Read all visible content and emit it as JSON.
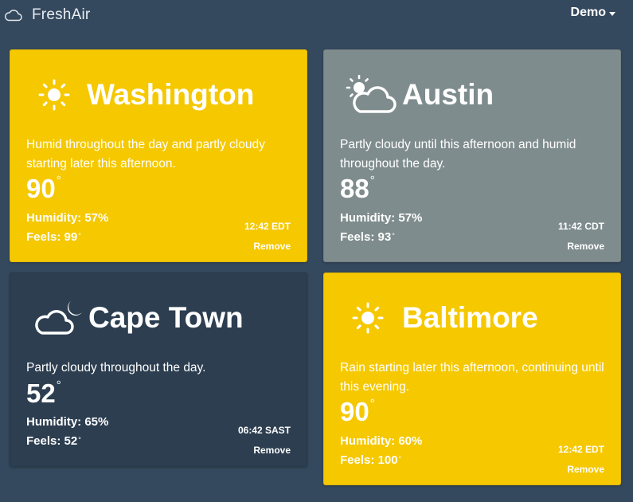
{
  "app": {
    "name": "FreshAir",
    "logo_icon": "cloud-outline-icon"
  },
  "user_menu": {
    "label": "Demo"
  },
  "colors": {
    "background": "#34495e",
    "sunny": "#f5c800",
    "cloudy": "#7f8c8d",
    "night": "#2c3e50"
  },
  "cards": [
    {
      "city": "Washington",
      "icon": "sun-icon",
      "summary": "Humid throughout the day and partly cloudy starting later this afternoon.",
      "temperature": "90",
      "humidity": "Humidity: 57%",
      "feels": "Feels: 99",
      "time": "12:42 EDT",
      "remove_label": "Remove"
    },
    {
      "city": "Austin",
      "icon": "partly-cloudy-day-icon",
      "summary": "Partly cloudy until this afternoon and humid throughout the day.",
      "temperature": "88",
      "humidity": "Humidity: 57%",
      "feels": "Feels: 93",
      "time": "11:42 CDT",
      "remove_label": "Remove"
    },
    {
      "city": "Cape Town",
      "icon": "partly-cloudy-night-icon",
      "summary": "Partly cloudy throughout the day.",
      "temperature": "52",
      "humidity": "Humidity: 65%",
      "feels": "Feels: 52",
      "time": "06:42 SAST",
      "remove_label": "Remove"
    },
    {
      "city": "Baltimore",
      "icon": "sun-icon",
      "summary": "Rain starting later this afternoon, continuing until this evening.",
      "temperature": "90",
      "humidity": "Humidity: 60%",
      "feels": "Feels: 100",
      "time": "12:42 EDT",
      "remove_label": "Remove"
    }
  ]
}
